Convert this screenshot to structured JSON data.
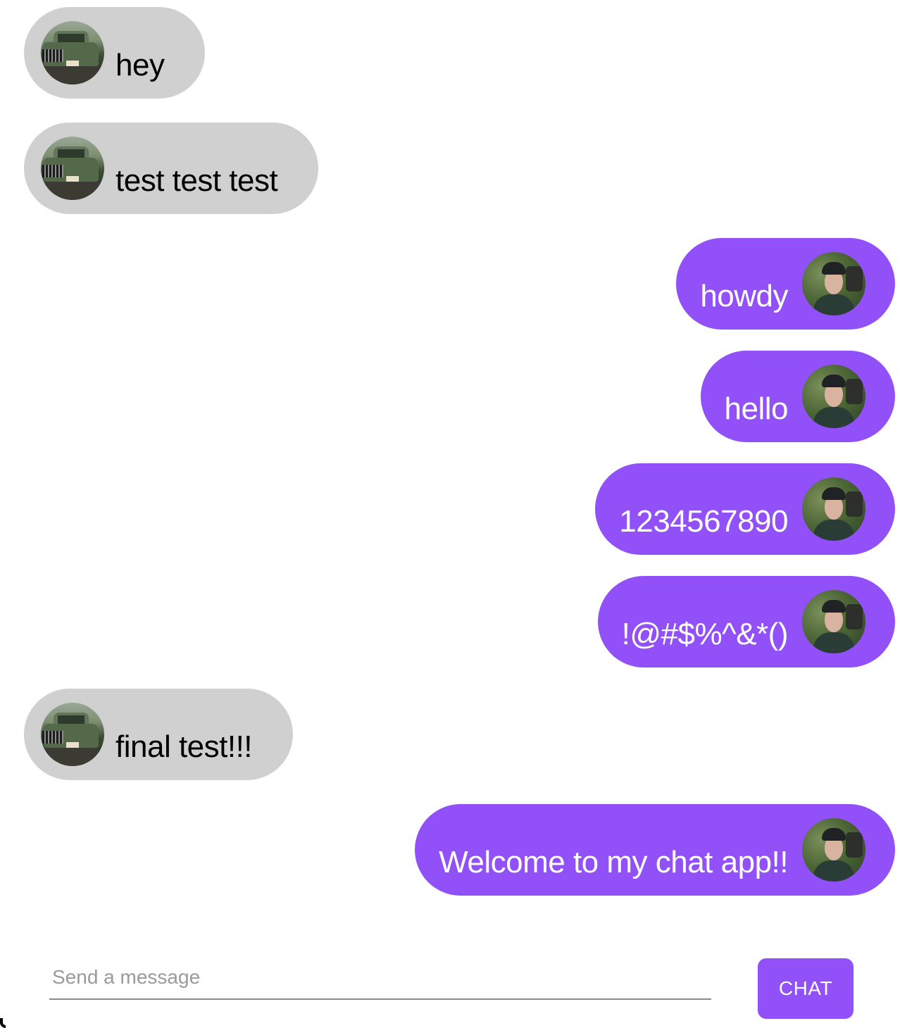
{
  "messages": [
    {
      "id": 1,
      "direction": "received",
      "avatar": "truck-avatar",
      "text": "hey"
    },
    {
      "id": 2,
      "direction": "received",
      "avatar": "truck-avatar",
      "text": "test test test"
    },
    {
      "id": 3,
      "direction": "sent",
      "avatar": "person-avatar",
      "text": "howdy"
    },
    {
      "id": 4,
      "direction": "sent",
      "avatar": "person-avatar",
      "text": "hello"
    },
    {
      "id": 5,
      "direction": "sent",
      "avatar": "person-avatar",
      "text": "1234567890"
    },
    {
      "id": 6,
      "direction": "sent",
      "avatar": "person-avatar",
      "text": "!@#$%^&*()"
    },
    {
      "id": 7,
      "direction": "received",
      "avatar": "truck-avatar",
      "text": "final test!!!"
    },
    {
      "id": 8,
      "direction": "sent",
      "avatar": "person-avatar",
      "text": "Welcome to my chat app!!"
    }
  ],
  "composer": {
    "placeholder": "Send a message",
    "value": "",
    "button_label": "CHAT"
  },
  "colors": {
    "sent_bubble": "#9150f8",
    "received_bubble": "#d0d0d0",
    "sent_text": "#ffffff",
    "received_text": "#000000",
    "button": "#9150f8"
  }
}
